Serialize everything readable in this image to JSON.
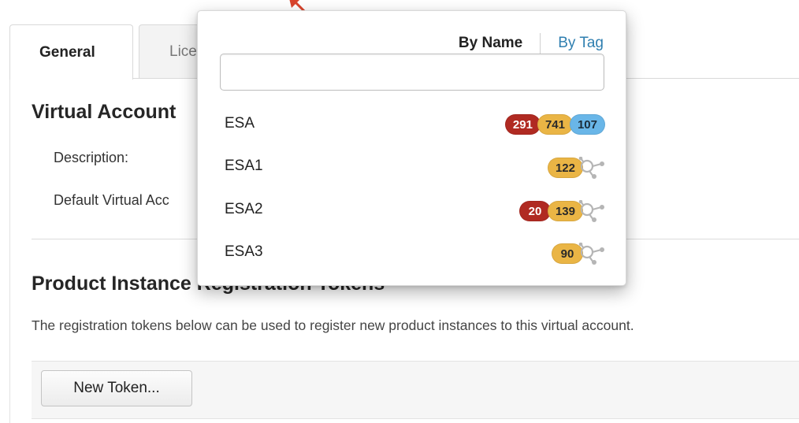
{
  "tabs": [
    {
      "label": "General"
    },
    {
      "label": "Lice"
    }
  ],
  "main": {
    "virtual_account_title": "Virtual Account",
    "description_label": "Description:",
    "default_label": "Default Virtual Acc",
    "tokens_title": "Product Instance Registration Tokens",
    "tokens_description": "The registration tokens below can be used to register new product instances to this virtual account.",
    "new_token_button": "New Token..."
  },
  "popover": {
    "by_name": "By Name",
    "by_tag": "By Tag",
    "search_placeholder": "",
    "accounts": [
      {
        "name": "ESA",
        "badges": [
          {
            "value": "291",
            "color": "red"
          },
          {
            "value": "741",
            "color": "orange"
          },
          {
            "value": "107",
            "color": "blue"
          }
        ],
        "share_icon": false
      },
      {
        "name": "ESA1",
        "badges": [
          {
            "value": "122",
            "color": "orange"
          }
        ],
        "share_icon": true
      },
      {
        "name": "ESA2",
        "badges": [
          {
            "value": "20",
            "color": "red"
          },
          {
            "value": "139",
            "color": "orange"
          }
        ],
        "share_icon": true
      },
      {
        "name": "ESA3",
        "badges": [
          {
            "value": "90",
            "color": "orange"
          }
        ],
        "share_icon": true
      }
    ]
  },
  "colors": {
    "badge_red": "#b02a22",
    "badge_orange": "#eab545",
    "badge_blue": "#69b6e8",
    "link": "#2f7fb0",
    "arrow": "#d9442c"
  },
  "icons": {
    "share": "share-nodes-icon",
    "annotation": "red-arrow"
  }
}
